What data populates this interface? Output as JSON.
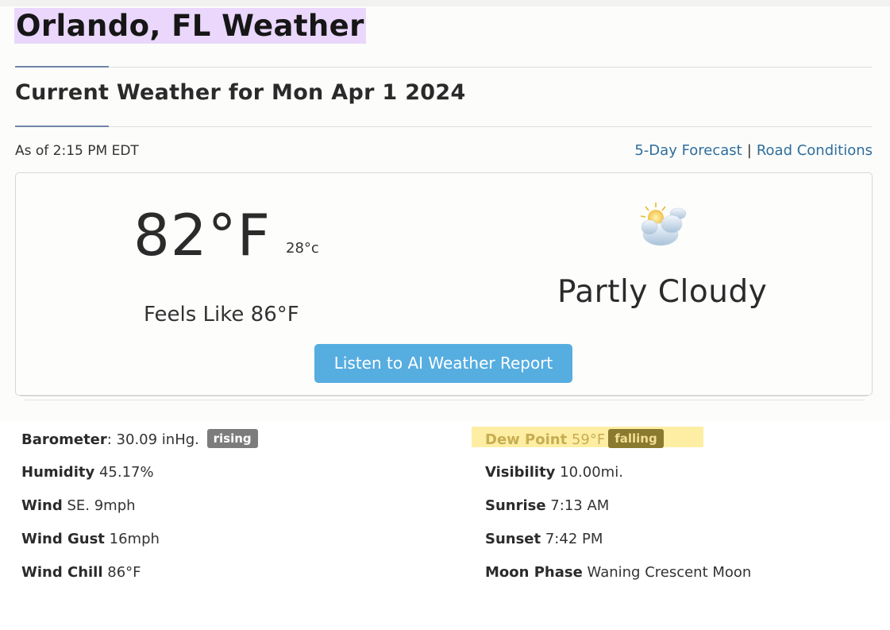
{
  "page": {
    "title": "Orlando, FL Weather",
    "section_title": "Current Weather for Mon Apr 1 2024",
    "as_of": "As of 2:15 PM EDT",
    "links": {
      "forecast": "5-Day Forecast",
      "separator": "|",
      "road": "Road Conditions"
    }
  },
  "current": {
    "temp_f": "82°F",
    "temp_c": "28°c",
    "feels_like": "Feels Like 86°F",
    "condition": "Partly Cloudy",
    "condition_icon": "partly-cloudy-icon",
    "ai_button": "Listen to AI Weather Report"
  },
  "details": {
    "barometer": {
      "label": "Barometer",
      "value": ": 30.09 inHg.",
      "trend": "rising"
    },
    "humidity": {
      "label": "Humidity",
      "value": "45.17%"
    },
    "wind": {
      "label": "Wind",
      "value": "SE. 9mph"
    },
    "wind_gust": {
      "label": "Wind Gust",
      "value": "16mph"
    },
    "wind_chill": {
      "label": "Wind Chill",
      "value": "86°F"
    },
    "dew_point": {
      "label": "Dew Point",
      "value": "59°F",
      "trend": "falling"
    },
    "visibility": {
      "label": "Visibility",
      "value": "10.00mi."
    },
    "sunrise": {
      "label": "Sunrise",
      "value": "7:13 AM"
    },
    "sunset": {
      "label": "Sunset",
      "value": "7:42 PM"
    },
    "moon_phase": {
      "label": "Moon Phase",
      "value": "Waning Crescent Moon"
    }
  },
  "colors": {
    "title_highlight": "#ead7fb",
    "link": "#2f6d9c",
    "button": "#56ade0",
    "badge": "#7c7c7c",
    "dew_highlight": "#fdeea3"
  }
}
